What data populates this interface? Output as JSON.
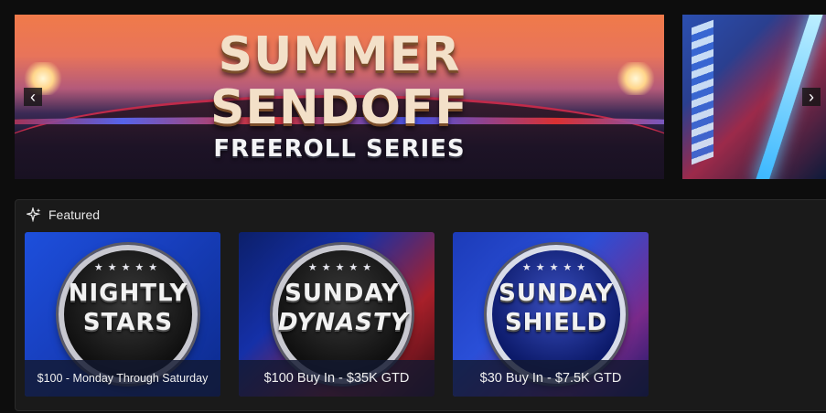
{
  "banners": {
    "main": {
      "title_line1": "SUMMER",
      "title_line2": "SENDOFF",
      "title_line3": "FREEROLL SERIES"
    }
  },
  "carousel": {
    "prev_icon": "chevron-left-icon",
    "next_icon": "chevron-right-icon",
    "prev_glyph": "‹",
    "next_glyph": "›"
  },
  "featured": {
    "title": "Featured",
    "icon": "sparkle-icon",
    "cards": [
      {
        "badge_line1": "NIGHTLY",
        "badge_line2": "STARS",
        "caption": "$100 - Monday Through Saturday"
      },
      {
        "badge_line1": "SUNDAY",
        "badge_line2": "DYNASTY",
        "caption": "$100 Buy In - $35K GTD"
      },
      {
        "badge_line1": "SUNDAY",
        "badge_line2": "SHIELD",
        "caption": "$30 Buy In - $7.5K GTD"
      }
    ]
  },
  "colors": {
    "background": "#0d0d0d",
    "panel": "#1a1a1a",
    "caption_bg": "#121830"
  }
}
